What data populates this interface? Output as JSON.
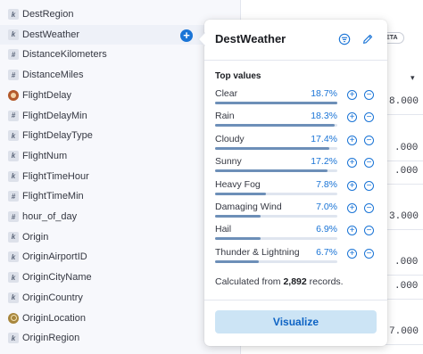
{
  "sidebar": {
    "fields": [
      {
        "name": "DestRegion",
        "type": "k",
        "icon": "keyword-type-icon"
      },
      {
        "name": "DestWeather",
        "type": "k",
        "icon": "keyword-type-icon"
      },
      {
        "name": "DistanceKilometers",
        "type": "#",
        "icon": "number-type-icon"
      },
      {
        "name": "DistanceMiles",
        "type": "#",
        "icon": "number-type-icon"
      },
      {
        "name": "FlightDelay",
        "type": "",
        "icon": "boolean-type-icon"
      },
      {
        "name": "FlightDelayMin",
        "type": "#",
        "icon": "number-type-icon"
      },
      {
        "name": "FlightDelayType",
        "type": "k",
        "icon": "keyword-type-icon"
      },
      {
        "name": "FlightNum",
        "type": "k",
        "icon": "keyword-type-icon"
      },
      {
        "name": "FlightTimeHour",
        "type": "k",
        "icon": "keyword-type-icon"
      },
      {
        "name": "FlightTimeMin",
        "type": "#",
        "icon": "number-type-icon"
      },
      {
        "name": "hour_of_day",
        "type": "#",
        "icon": "number-type-icon"
      },
      {
        "name": "Origin",
        "type": "k",
        "icon": "keyword-type-icon"
      },
      {
        "name": "OriginAirportID",
        "type": "k",
        "icon": "keyword-type-icon"
      },
      {
        "name": "OriginCityName",
        "type": "k",
        "icon": "keyword-type-icon"
      },
      {
        "name": "OriginCountry",
        "type": "k",
        "icon": "keyword-type-icon"
      },
      {
        "name": "OriginLocation",
        "type": "",
        "icon": "geo-point-type-icon"
      },
      {
        "name": "OriginRegion",
        "type": "k",
        "icon": "keyword-type-icon"
      }
    ],
    "add_label": "+"
  },
  "background": {
    "beta_label": "BETA",
    "caret": "▾",
    "values": [
      "8.000",
      ".000",
      ".000",
      "3.000",
      ".000",
      ".000",
      "7.000"
    ]
  },
  "popover": {
    "title": "DestWeather",
    "filter_icon": "filter-icon",
    "edit_icon": "pencil-icon",
    "section_title": "Top values",
    "top_values": [
      {
        "label": "Clear",
        "pct": "18.7%",
        "fraction": 0.187
      },
      {
        "label": "Rain",
        "pct": "18.3%",
        "fraction": 0.183
      },
      {
        "label": "Cloudy",
        "pct": "17.4%",
        "fraction": 0.174
      },
      {
        "label": "Sunny",
        "pct": "17.2%",
        "fraction": 0.172
      },
      {
        "label": "Heavy Fog",
        "pct": "7.8%",
        "fraction": 0.078
      },
      {
        "label": "Damaging Wind",
        "pct": "7.0%",
        "fraction": 0.07
      },
      {
        "label": "Hail",
        "pct": "6.9%",
        "fraction": 0.069
      },
      {
        "label": "Thunder & Lightning",
        "pct": "6.7%",
        "fraction": 0.067
      }
    ],
    "plus_glyph": "+",
    "minus_glyph": "−",
    "calc_prefix": "Calculated from ",
    "calc_count": "2,892",
    "calc_suffix": " records.",
    "visualize_label": "Visualize"
  },
  "colors": {
    "accent": "#1a74d6",
    "bar_fill": "#6d8fb8",
    "bar_track": "#dfe5ef",
    "visualize_bg": "#cce4f5"
  }
}
